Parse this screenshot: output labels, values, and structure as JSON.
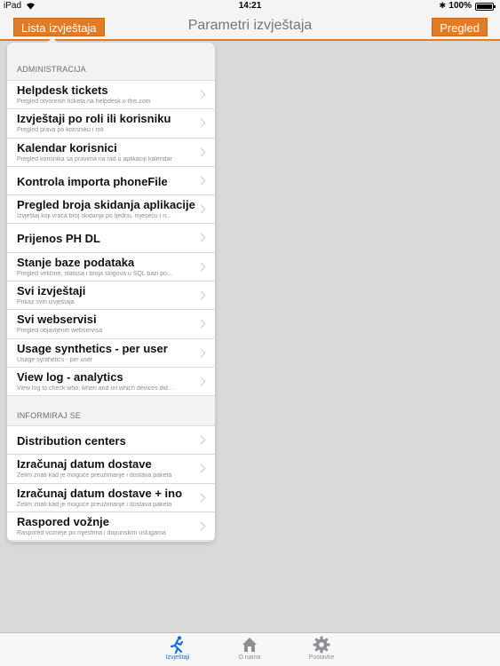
{
  "status_bar": {
    "carrier": "iPad",
    "time": "14:21",
    "battery": "100%"
  },
  "nav": {
    "left_button": "Lista izvještaja",
    "title": "Parametri izvještaja",
    "right_button": "Pregled"
  },
  "sections": [
    {
      "header": "ADMINISTRACIJA",
      "items": [
        {
          "title": "Helpdesk tickets",
          "subtitle": "Pregled otvorenih ticketa na helpdesk.x-this.com"
        },
        {
          "title": "Izvještaji po roli ili korisniku",
          "subtitle": "Pregled prava po korisniku i roli"
        },
        {
          "title": "Kalendar korisnici",
          "subtitle": "Pregled korisnika sa pravima na rad u aplikaciji kalendar"
        },
        {
          "title": "Kontrola importa phoneFile",
          "subtitle": ""
        },
        {
          "title": "Pregled broja skidanja aplikacije",
          "subtitle": "Izvještaj koji vraća broj skidanja po tjednu, mjesecu i n..."
        },
        {
          "title": "Prijenos PH DL",
          "subtitle": ""
        },
        {
          "title": "Stanje baze podataka",
          "subtitle": "Pregled veličine, statusa i broja slogova u SQL bazi po..."
        },
        {
          "title": "Svi izvještaji",
          "subtitle": "Prikaz svih izvještaja"
        },
        {
          "title": "Svi webservisi",
          "subtitle": "Pregled objavljenih webservisa"
        },
        {
          "title": "Usage synthetics - per user",
          "subtitle": "Usage synthetics - per user"
        },
        {
          "title": "View log - analytics",
          "subtitle": "View log to check who, when and on which devices did..."
        }
      ]
    },
    {
      "header": "INFORMIRAJ SE",
      "items": [
        {
          "title": "Distribution centers",
          "subtitle": ""
        },
        {
          "title": "Izračunaj datum dostave",
          "subtitle": "Želim znati kad je moguće preuzimanje i dostava paketa"
        },
        {
          "title": "Izračunaj datum dostave + ino",
          "subtitle": "Želim znati kad je moguće preuzimanje i dostava paketa"
        },
        {
          "title": "Raspored vožnje",
          "subtitle": "Raspored vozneje po mjestima i dopunskim uslugama"
        }
      ]
    }
  ],
  "tabs": [
    {
      "label": "Izvještaji",
      "icon": "runner-icon",
      "active": true
    },
    {
      "label": "O nama",
      "icon": "house-icon",
      "active": false
    },
    {
      "label": "Postavke",
      "icon": "gear-icon",
      "active": false
    }
  ],
  "colors": {
    "accent": "#e07b28",
    "tab_active": "#1a6fd6",
    "background": "#d9d9d9"
  }
}
